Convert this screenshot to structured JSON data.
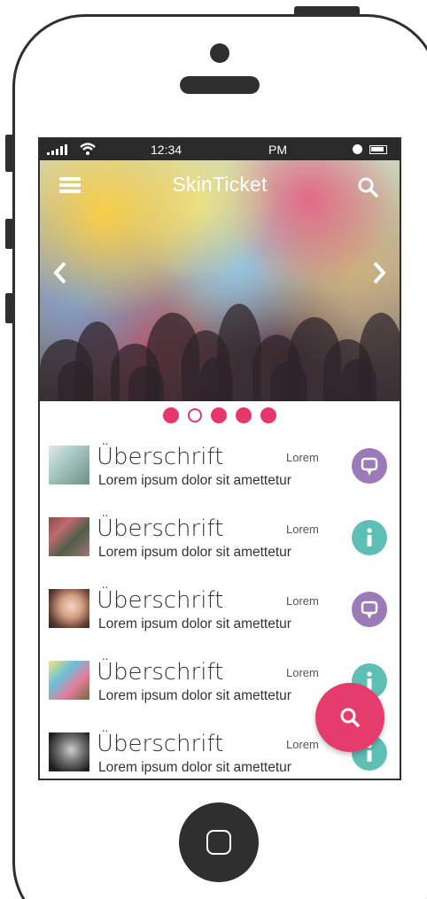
{
  "status_bar": {
    "time": "12:34",
    "ampm": "PM"
  },
  "app": {
    "title": "SkinTicket"
  },
  "carousel": {
    "total": 5,
    "active_index": 1,
    "prev_icon": "chevron-left-icon",
    "next_icon": "chevron-right-icon"
  },
  "colors": {
    "accent": "#e6366c",
    "purple": "#9a7ab8",
    "teal": "#5ebfb4",
    "frame": "#2f2f2f"
  },
  "list": {
    "items": [
      {
        "title": "Überschrift",
        "meta": "Lorem",
        "subtitle": "Lorem ipsum dolor sit amettetur",
        "action_icon": "chat-icon",
        "action_color": "#9a7ab8"
      },
      {
        "title": "Überschrift",
        "meta": "Lorem",
        "subtitle": "Lorem ipsum dolor sit amettetur",
        "action_icon": "info-icon",
        "action_color": "#5ebfb4"
      },
      {
        "title": "Überschrift",
        "meta": "Lorem",
        "subtitle": "Lorem ipsum dolor sit amettetur",
        "action_icon": "chat-icon",
        "action_color": "#9a7ab8"
      },
      {
        "title": "Überschrift",
        "meta": "Lorem",
        "subtitle": "Lorem ipsum dolor sit amettetur",
        "action_icon": "info-icon",
        "action_color": "#5ebfb4"
      },
      {
        "title": "Überschrift",
        "meta": "Lorem",
        "subtitle": "Lorem ipsum dolor sit amettetur",
        "action_icon": "info-icon",
        "action_color": "#5ebfb4"
      }
    ]
  },
  "fab": {
    "icon": "search-icon"
  }
}
